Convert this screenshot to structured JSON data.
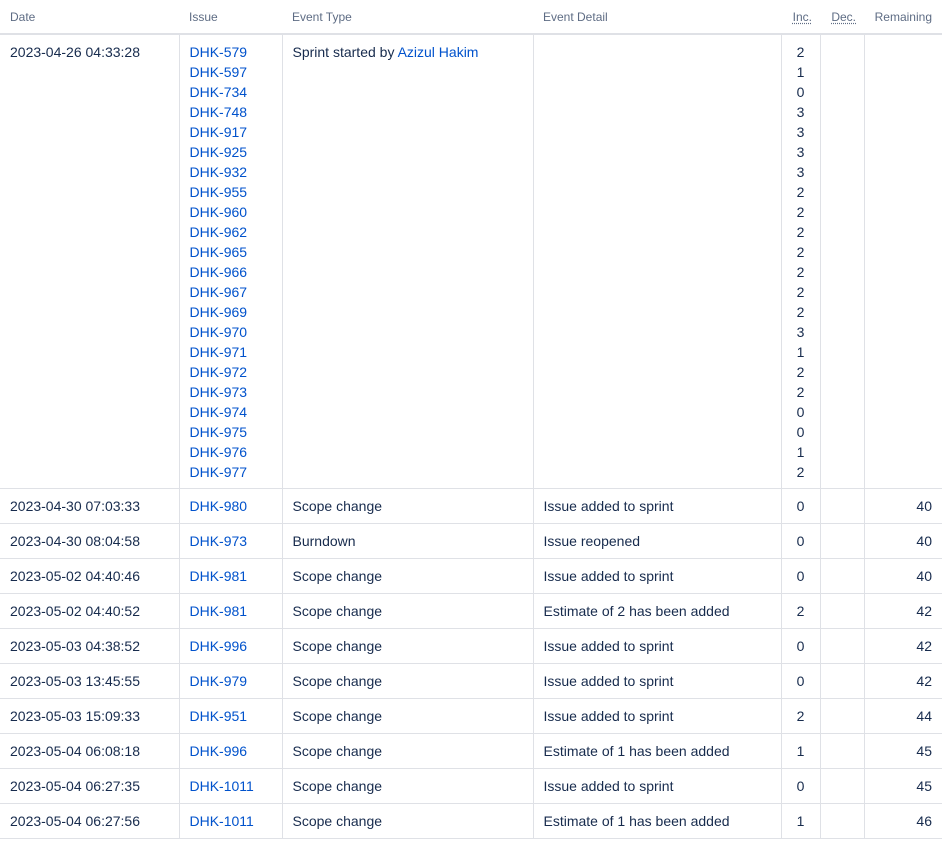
{
  "headers": {
    "date": "Date",
    "issue": "Issue",
    "event_type": "Event Type",
    "event_detail": "Event Detail",
    "inc": "Inc.",
    "dec": "Dec.",
    "remaining": "Remaining"
  },
  "sprint_start": {
    "date": "2023-04-26 04:33:28",
    "event_type_prefix": "Sprint started by ",
    "user": "Azizul Hakim",
    "issues": [
      "DHK-579",
      "DHK-597",
      "DHK-734",
      "DHK-748",
      "DHK-917",
      "DHK-925",
      "DHK-932",
      "DHK-955",
      "DHK-960",
      "DHK-962",
      "DHK-965",
      "DHK-966",
      "DHK-967",
      "DHK-969",
      "DHK-970",
      "DHK-971",
      "DHK-972",
      "DHK-973",
      "DHK-974",
      "DHK-975",
      "DHK-976",
      "DHK-977"
    ],
    "inc": [
      "2",
      "1",
      "0",
      "3",
      "3",
      "3",
      "3",
      "2",
      "2",
      "2",
      "2",
      "2",
      "2",
      "2",
      "3",
      "1",
      "2",
      "2",
      "0",
      "0",
      "1",
      "2"
    ]
  },
  "rows": [
    {
      "date": "2023-04-30 07:03:33",
      "issue": "DHK-980",
      "event_type": "Scope change",
      "event_detail": "Issue added to sprint",
      "inc": "0",
      "dec": "",
      "remaining": "40"
    },
    {
      "date": "2023-04-30 08:04:58",
      "issue": "DHK-973",
      "event_type": "Burndown",
      "event_detail": "Issue reopened",
      "inc": "0",
      "dec": "",
      "remaining": "40"
    },
    {
      "date": "2023-05-02 04:40:46",
      "issue": "DHK-981",
      "event_type": "Scope change",
      "event_detail": "Issue added to sprint",
      "inc": "0",
      "dec": "",
      "remaining": "40"
    },
    {
      "date": "2023-05-02 04:40:52",
      "issue": "DHK-981",
      "event_type": "Scope change",
      "event_detail": "Estimate of 2 has been added",
      "inc": "2",
      "dec": "",
      "remaining": "42"
    },
    {
      "date": "2023-05-03 04:38:52",
      "issue": "DHK-996",
      "event_type": "Scope change",
      "event_detail": "Issue added to sprint",
      "inc": "0",
      "dec": "",
      "remaining": "42"
    },
    {
      "date": "2023-05-03 13:45:55",
      "issue": "DHK-979",
      "event_type": "Scope change",
      "event_detail": "Issue added to sprint",
      "inc": "0",
      "dec": "",
      "remaining": "42"
    },
    {
      "date": "2023-05-03 15:09:33",
      "issue": "DHK-951",
      "event_type": "Scope change",
      "event_detail": "Issue added to sprint",
      "inc": "2",
      "dec": "",
      "remaining": "44"
    },
    {
      "date": "2023-05-04 06:08:18",
      "issue": "DHK-996",
      "event_type": "Scope change",
      "event_detail": "Estimate of 1 has been added",
      "inc": "1",
      "dec": "",
      "remaining": "45"
    },
    {
      "date": "2023-05-04 06:27:35",
      "issue": "DHK-1011",
      "event_type": "Scope change",
      "event_detail": "Issue added to sprint",
      "inc": "0",
      "dec": "",
      "remaining": "45"
    },
    {
      "date": "2023-05-04 06:27:56",
      "issue": "DHK-1011",
      "event_type": "Scope change",
      "event_detail": "Estimate of 1 has been added",
      "inc": "1",
      "dec": "",
      "remaining": "46"
    }
  ]
}
